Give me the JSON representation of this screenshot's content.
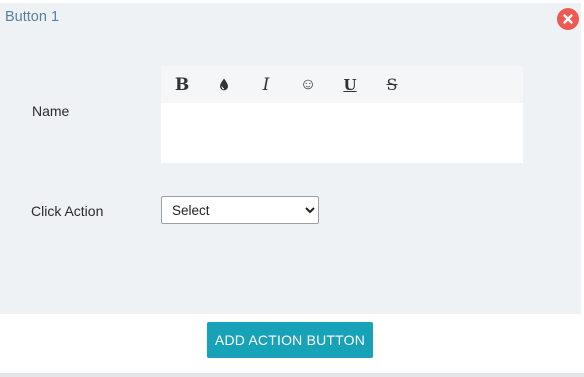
{
  "panel": {
    "title": "Button 1",
    "close_icon": "close-icon",
    "close_color": "#ee5a52"
  },
  "form": {
    "name_label": "Name",
    "click_action_label": "Click Action",
    "click_action_selected": "Select"
  },
  "toolbar": {
    "buttons": [
      {
        "icon": "bold-icon",
        "glyph": "B"
      },
      {
        "icon": "color-drop-icon",
        "glyph": "💧"
      },
      {
        "icon": "italic-icon",
        "glyph": "I"
      },
      {
        "icon": "emoji-icon",
        "glyph": "☺"
      },
      {
        "icon": "underline-icon",
        "glyph": "U"
      },
      {
        "icon": "strikethrough-icon",
        "glyph": "S"
      }
    ]
  },
  "footer": {
    "add_button_label": "ADD ACTION BUTTON",
    "accent": "#17a2b8"
  }
}
